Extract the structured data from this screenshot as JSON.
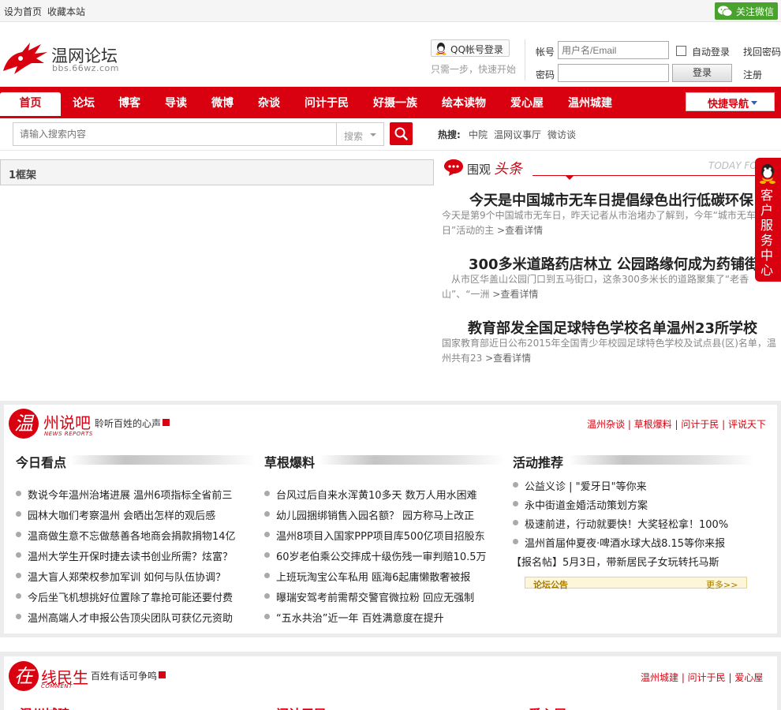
{
  "topbar": {
    "set_home": "设为首页",
    "bookmark": "收藏本站",
    "wechat": "关注微信"
  },
  "header": {
    "site_name": "温网论坛",
    "site_domain": "bbs.66wz.com",
    "qq_login": "QQ帐号登录",
    "qq_tip": "只需一步，快速开始",
    "account_label": "帐号",
    "account_placeholder": "用户名/Email",
    "password_label": "密码",
    "auto_login": "自动登录",
    "find_password": "找回密码",
    "login_button": "登录",
    "register": "注册"
  },
  "nav": {
    "items": [
      "首页",
      "论坛",
      "博客",
      "导读",
      "微博",
      "杂谈",
      "问计于民",
      "好摄一族",
      "绘本读物",
      "爱心屋",
      "温州城建"
    ],
    "quick_nav": "快捷导航"
  },
  "search": {
    "placeholder": "请输入搜索内容",
    "type": "搜索",
    "hot_label": "热搜:",
    "hot_terms": [
      "中院",
      "温网议事厅",
      "微访谈"
    ]
  },
  "frame": {
    "label": "1框架"
  },
  "headlines": {
    "title": "围观",
    "title_accent": "头条",
    "today": "TODAY FO",
    "items": [
      {
        "title": "今天是中国城市无车日提倡绿色出行低碳环保",
        "summary": "今天是第9个中国城市无车日，昨天记者从市治堵办了解到，今年“城市无车日”活动的主",
        "more": ">查看详情"
      },
      {
        "title": "300多米道路药店林立 公园路缘何成为药铺街",
        "summary": "　从市区华盖山公园门口到五马街口，这条300多米长的道路聚集了“老香山”、“一洲",
        "more": ">查看详情"
      },
      {
        "title": "教育部发全国足球特色学校名单温州23所学校",
        "summary": "国家教育部近日公布2015年全国青少年校园足球特色学校及试点县(区)名单，温州共有23",
        "more": ">查看详情"
      }
    ]
  },
  "service_tab": {
    "label": "客户服务中心"
  },
  "section1": {
    "logo_char": "温",
    "name": "州说吧",
    "english": "NEWS REPORTS",
    "slogan": "聆听百姓的心声",
    "links": "温州杂谈 | 草根爆料 | 问计于民 | 评说天下",
    "columns": [
      {
        "title": "今日看点",
        "items": [
          "数说今年温州治堵进展 温州6项指标全省前三",
          "园林大咖们考察温州 会晒出怎样的观后感",
          "温商做生意不忘做慈善各地商会捐款捐物14亿",
          "温州大学生开保时捷去读书创业所需？炫富？",
          "温大盲人郑荣权参加军训 如何与队伍协调？",
          "今后坐飞机想挑好位置除了靠抢可能还要付费",
          "温州高端人才申报公告顶尖团队可获亿元资助"
        ]
      },
      {
        "title": "草根爆料",
        "items": [
          "台风过后自来水浑黄10多天 数万人用水困难",
          "幼儿园捆绑销售入园名额？ 园方称马上改正",
          "温州8项目入国家PPP项目库500亿项目招股东",
          "60岁老伯乘公交摔成十级伤残一审判赔10.5万",
          "上班玩淘宝公车私用 瓯海6起庸懒散奢被报",
          "曝瑞安驾考前需帮交警官微拉粉 回应无强制",
          "“五水共治”近一年 百姓满意度在提升"
        ]
      },
      {
        "title": "活动推荐",
        "items": [
          "公益义诊 | \"爱牙日\"等你来",
          "永中街道金婚活动策划方案",
          "极速前进，行动就要快！大奖轻松拿！100%",
          "温州首届仲夏夜·啤酒水球大战8.15等你来报",
          "【报名帖】5月3日，带新居民子女玩转托马斯"
        ]
      }
    ],
    "notice": {
      "title": "论坛公告",
      "more": "更多>>"
    }
  },
  "section2": {
    "logo_char": "在",
    "name": "线民生",
    "english": "COMMENT",
    "slogan": "百姓有话可争鸣",
    "links": "温州城建 | 问计于民 | 爱心屋",
    "columns": [
      "温州城建",
      "问计于民",
      "爱心屋"
    ]
  },
  "colors": {
    "brand_red": "#d9000f",
    "wechat_green": "#49a22e"
  }
}
